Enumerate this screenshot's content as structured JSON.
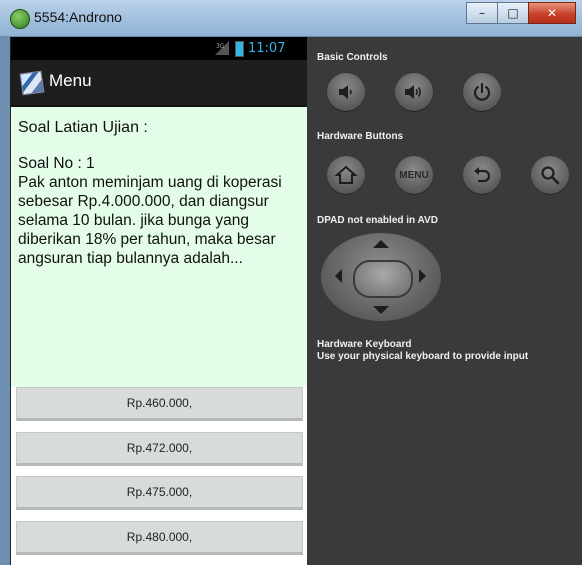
{
  "window": {
    "title": "5554:Androno",
    "buttons": [
      "minimize",
      "maximize",
      "close"
    ]
  },
  "statusbar": {
    "signal": "3G",
    "time": "11:07"
  },
  "actionbar": {
    "title": "Menu"
  },
  "quiz": {
    "heading": "Soal Latian Ujian :",
    "question_number": "Soal No : 1",
    "question_text": "Pak anton meminjam uang di koperasi sebesar Rp.4.000.000, dan diangsur selama 10 bulan. jika bunga yang diberikan 18% per tahun, maka besar angsuran tiap bulannya adalah...",
    "answers": [
      "Rp.460.000,",
      "Rp.472.000,",
      "Rp.475.000,",
      "Rp.480.000,"
    ]
  },
  "controls": {
    "basic_label": "Basic Controls",
    "hardware_label": "Hardware Buttons",
    "menu_button_text": "MENU",
    "dpad_label": "DPAD not enabled in AVD",
    "keyboard_label": "Hardware Keyboard",
    "keyboard_hint": "Use your physical keyboard to provide input"
  },
  "colors": {
    "accent": "#33b5e5",
    "content_bg": "#e4fde8",
    "panel_bg": "#3a3a3a"
  }
}
